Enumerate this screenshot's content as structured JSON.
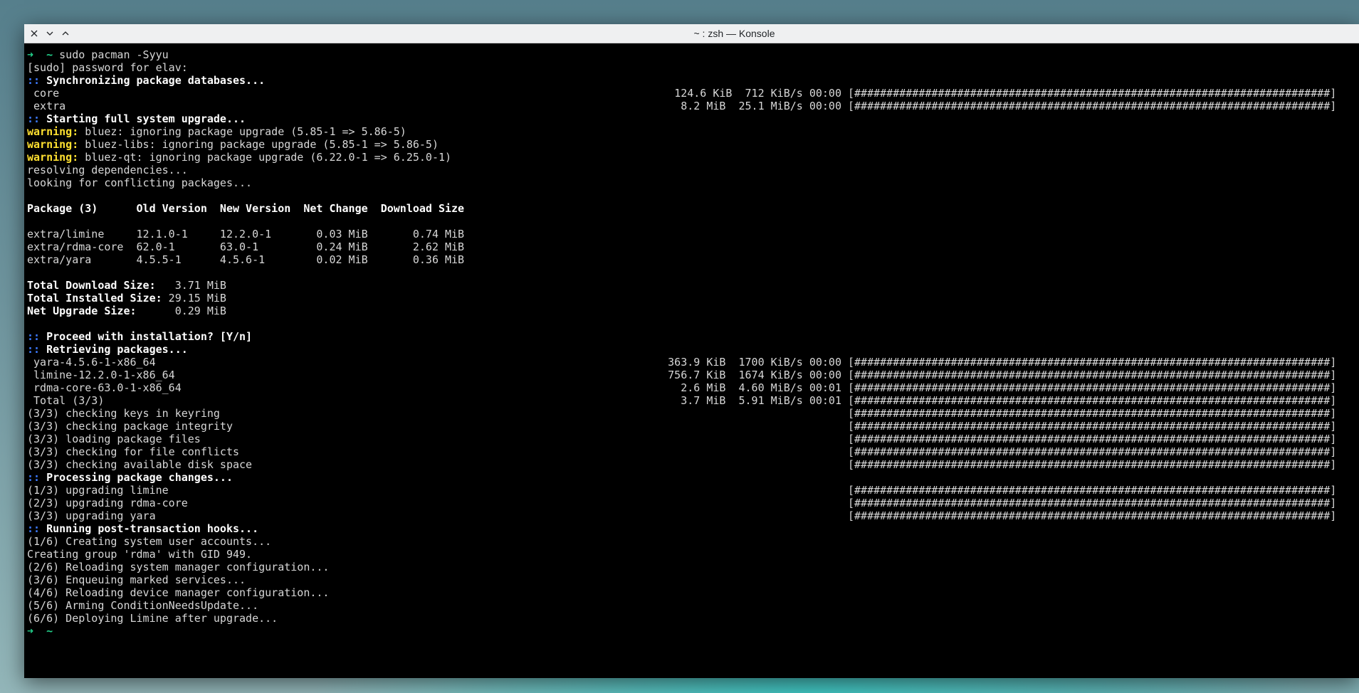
{
  "window": {
    "title": "~ : zsh — Konsole",
    "buttons": [
      "close-icon",
      "minimize-icon",
      "maximize-icon"
    ]
  },
  "colors": {
    "prompt": "#23d18b",
    "marker": "#3d7bff",
    "warning": "#ffe030",
    "text": "#d7d7d7",
    "background": "#000000",
    "titlebar": "#eff0f1"
  },
  "terminal": {
    "prompt_arrow": "➜",
    "prompt_dir": "~",
    "command": "sudo pacman -Syyu",
    "sudo_prompt": "[sudo] password for elav:",
    "sync_header": "Synchronizing package databases...",
    "sync_rows": [
      {
        "name": "core",
        "size": "124.6 KiB",
        "speed": "712 KiB/s",
        "time": "00:00",
        "bar": "[##########################################################################]"
      },
      {
        "name": "extra",
        "size": "8.2 MiB",
        "speed": "25.1 MiB/s",
        "time": "00:00",
        "bar": "[##########################################################################]"
      }
    ],
    "upgrade_header": "Starting full system upgrade...",
    "warning_label": "warning:",
    "warnings": [
      "bluez: ignoring package upgrade (5.85-1 => 5.86-5)",
      "bluez-libs: ignoring package upgrade (5.85-1 => 5.86-5)",
      "bluez-qt: ignoring package upgrade (6.22.0-1 => 6.25.0-1)"
    ],
    "resolving": "resolving dependencies...",
    "conflicts": "looking for conflicting packages...",
    "table_header": "Package (3)      Old Version  New Version  Net Change  Download Size",
    "table_rows": [
      "extra/limine     12.1.0-1     12.2.0-1       0.03 MiB       0.74 MiB",
      "extra/rdma-core  62.0-1       63.0-1         0.24 MiB       2.62 MiB",
      "extra/yara       4.5.5-1      4.5.6-1        0.02 MiB       0.36 MiB"
    ],
    "totals": [
      {
        "label": "Total Download Size: ",
        "value": "  3.71 MiB"
      },
      {
        "label": "Total Installed Size:",
        "value": " 29.15 MiB"
      },
      {
        "label": "Net Upgrade Size:    ",
        "value": "  0.29 MiB"
      }
    ],
    "proceed": "Proceed with installation? [Y/n]",
    "retrieving": "Retrieving packages...",
    "retrieve_rows": [
      {
        "name": "yara-4.5.6-1-x86_64",
        "size": "363.9 KiB",
        "speed": "1700 KiB/s",
        "time": "00:00",
        "bar": "[##########################################################################]"
      },
      {
        "name": "limine-12.2.0-1-x86_64",
        "size": "756.7 KiB",
        "speed": "1674 KiB/s",
        "time": "00:00",
        "bar": "[##########################################################################]"
      },
      {
        "name": "rdma-core-63.0-1-x86_64",
        "size": "2.6 MiB",
        "speed": "4.60 MiB/s",
        "time": "00:01",
        "bar": "[##########################################################################]"
      },
      {
        "name": "Total (3/3)",
        "size": "3.7 MiB",
        "speed": "5.91 MiB/s",
        "time": "00:01",
        "bar": "[##########################################################################]"
      }
    ],
    "check_rows": [
      {
        "text": "(3/3) checking keys in keyring",
        "bar": "[##########################################################################]"
      },
      {
        "text": "(3/3) checking package integrity",
        "bar": "[##########################################################################]"
      },
      {
        "text": "(3/3) loading package files",
        "bar": "[##########################################################################]"
      },
      {
        "text": "(3/3) checking for file conflicts",
        "bar": "[##########################################################################]"
      },
      {
        "text": "(3/3) checking available disk space",
        "bar": "[##########################################################################]"
      }
    ],
    "processing": "Processing package changes...",
    "process_rows": [
      {
        "text": "(1/3) upgrading limine",
        "bar": "[##########################################################################]"
      },
      {
        "text": "(2/3) upgrading rdma-core",
        "bar": "[##########################################################################]"
      },
      {
        "text": "(3/3) upgrading yara",
        "bar": "[##########################################################################]"
      }
    ],
    "hooks": "Running post-transaction hooks...",
    "hook_rows": [
      "(1/6) Creating system user accounts...",
      "Creating group 'rdma' with GID 949.",
      "(2/6) Reloading system manager configuration...",
      "(3/6) Enqueuing marked services...",
      "(4/6) Reloading device manager configuration...",
      "(5/6) Arming ConditionNeedsUpdate...",
      "(6/6) Deploying Limine after upgrade..."
    ],
    "marker": "::"
  }
}
